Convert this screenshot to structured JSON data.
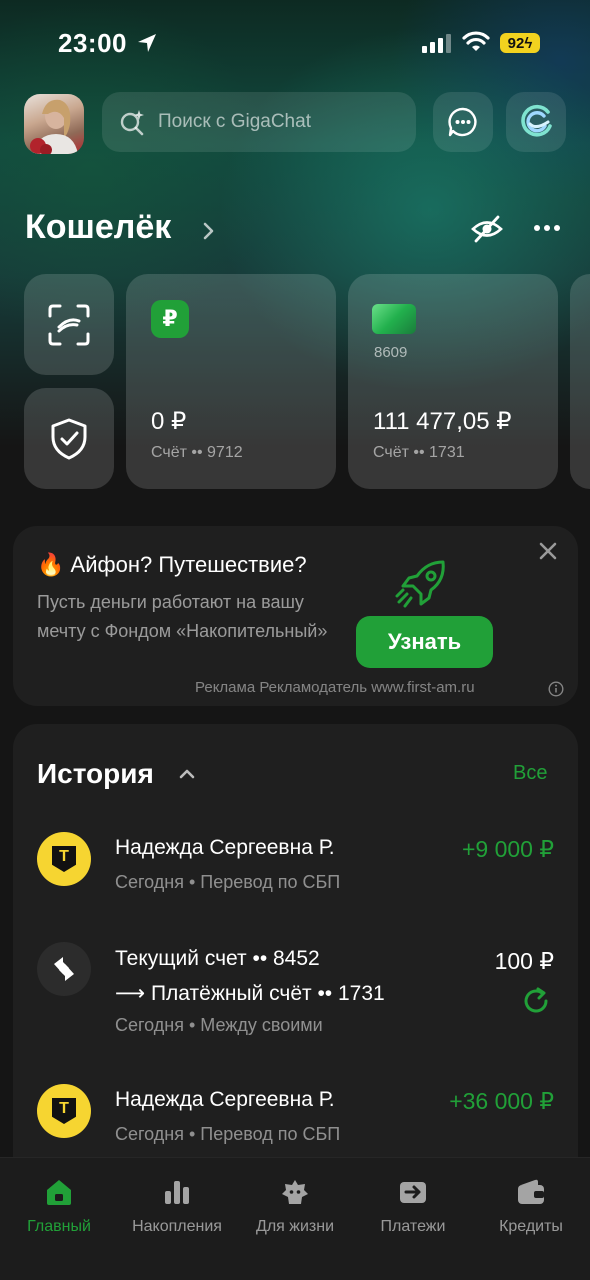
{
  "status_bar": {
    "time": "23:00",
    "battery": "92"
  },
  "top": {
    "search_placeholder": "Поиск с GigaChat",
    "icons": [
      "avatar",
      "sparkle-search-icon",
      "chat-icon",
      "gigachat-logo-icon"
    ]
  },
  "wallet": {
    "title": "Кошелёк",
    "accounts": [
      {
        "icon": "ruble-icon",
        "card_number": "",
        "amount": "0 ₽",
        "label": "Счёт •• 9712"
      },
      {
        "icon": "card-icon",
        "card_number": "8609",
        "amount": "111 477,05 ₽",
        "label": "Счёт •• 1731"
      }
    ]
  },
  "promo": {
    "title": "Айфон? Путешествие?",
    "text": "Пусть деньги работают на вашу мечту с Фондом «Накопительный»",
    "button": "Узнать",
    "ad": "Реклама Рекламодатель www.first-am.ru"
  },
  "history": {
    "title": "История",
    "all_label": "Все",
    "transactions": [
      {
        "name": "Надежда Сергеевна Р.",
        "sub": "Сегодня • Перевод по СБП",
        "amount": "+9 000 ₽"
      },
      {
        "name": "Текущий счет •• 8452",
        "name2": "Платёжный счёт •• 1731",
        "sub": "Сегодня • Между своими",
        "amount": "100 ₽"
      },
      {
        "name": "Надежда Сергеевна Р.",
        "sub": "Сегодня • Перевод по СБП",
        "amount": "+36 000 ₽"
      }
    ]
  },
  "nav": {
    "items": [
      {
        "label": "Главный",
        "active": true
      },
      {
        "label": "Накопления",
        "active": false
      },
      {
        "label": "Для жизни",
        "active": false
      },
      {
        "label": "Платежи",
        "active": false
      },
      {
        "label": "Кредиты",
        "active": false
      }
    ]
  },
  "colors": {
    "accent": "#21a038",
    "card_bg": "#1f1f1f",
    "badge_yellow": "#f6d531"
  }
}
